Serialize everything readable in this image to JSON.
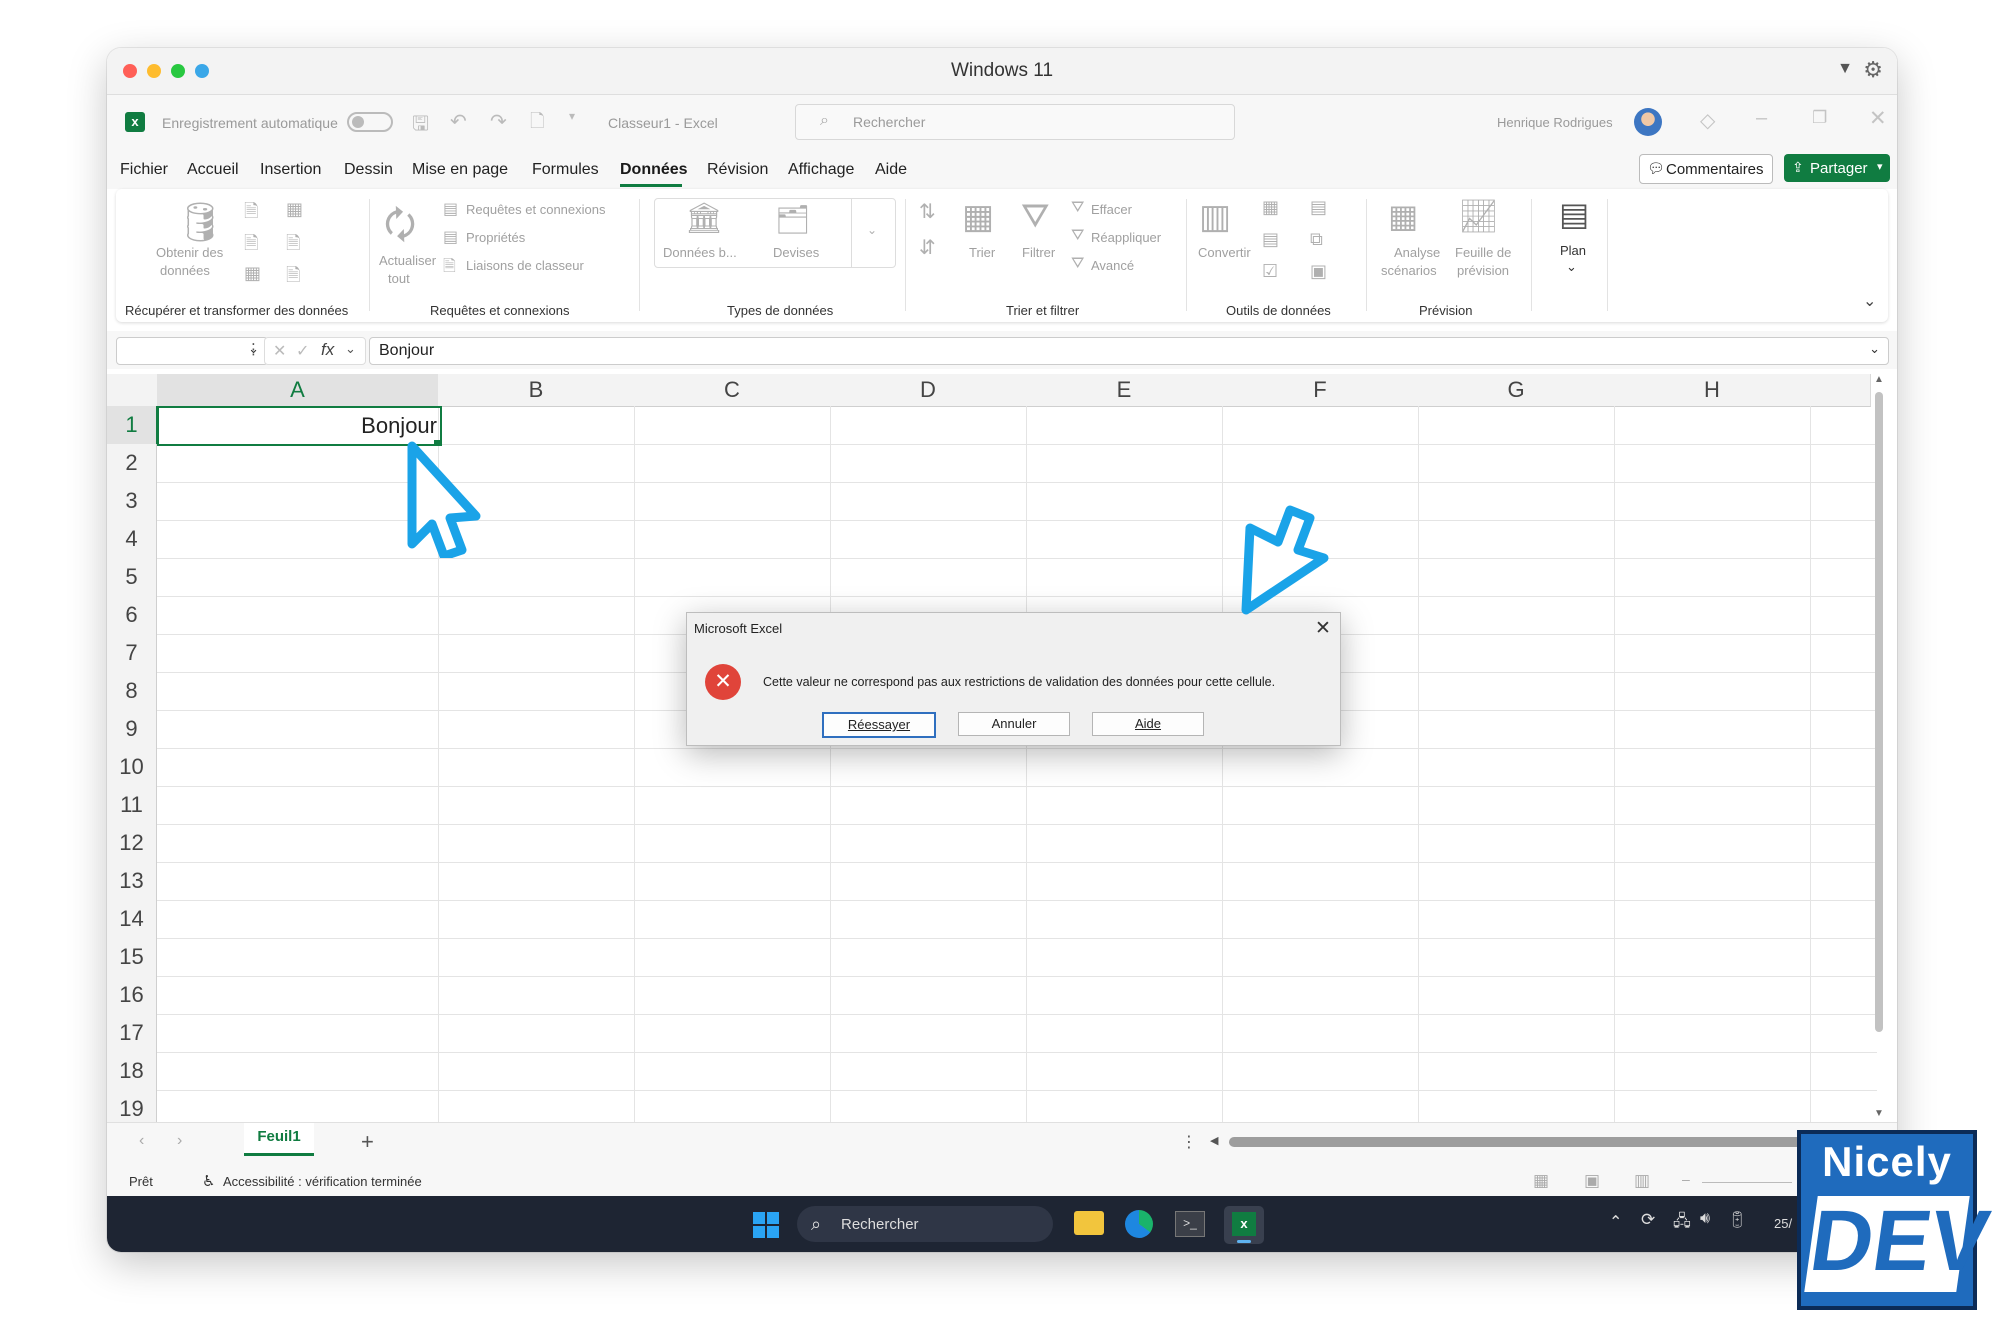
{
  "mac": {
    "title": "Windows 11"
  },
  "excel": {
    "autosave_label": "Enregistrement automatique",
    "doc_name": "Classeur1",
    "app_name": "Excel",
    "doc_sep": "-",
    "search_placeholder": "Rechercher",
    "user_name": "Henrique Rodrigues"
  },
  "menu": {
    "items": [
      "Fichier",
      "Accueil",
      "Insertion",
      "Dessin",
      "Mise en page",
      "Formules",
      "Données",
      "Révision",
      "Affichage",
      "Aide"
    ],
    "active": "Données",
    "comments": "Commentaires",
    "share": "Partager"
  },
  "ribbon": {
    "get_data": "Obtenir des",
    "get_data2": "données",
    "refresh": "Actualiser",
    "refresh2": "tout",
    "queries": "Requêtes et connexions",
    "properties": "Propriétés",
    "links": "Liaisons de classeur",
    "stock": "Données b...",
    "currencies": "Devises",
    "sort": "Trier",
    "filter": "Filtrer",
    "clear": "Effacer",
    "reapply": "Réappliquer",
    "advanced": "Avancé",
    "convert": "Convertir",
    "whatif": "Analyse",
    "whatif2": "scénarios",
    "forecast": "Feuille de",
    "forecast2": "prévision",
    "outline": "Plan",
    "groups": [
      "Récupérer et transformer des données",
      "Requêtes et connexions",
      "Types de données",
      "Trier et filtrer",
      "Outils de données",
      "Prévision"
    ]
  },
  "formula_bar": {
    "fx": "fx",
    "value": "Bonjour"
  },
  "grid": {
    "columns": [
      "A",
      "B",
      "C",
      "D",
      "E",
      "F",
      "G",
      "H"
    ],
    "rows": [
      "1",
      "2",
      "3",
      "4",
      "5",
      "6",
      "7",
      "8",
      "9",
      "10",
      "11",
      "12",
      "13",
      "14",
      "15",
      "16",
      "17",
      "18",
      "19"
    ],
    "a1": "Bonjour"
  },
  "sheets": {
    "tab": "Feuil1",
    "add": "+"
  },
  "status": {
    "ready": "Prêt",
    "accessibility": "Accessibilité : vérification terminée"
  },
  "taskbar": {
    "search": "Rechercher",
    "date": "25/"
  },
  "dialog": {
    "title": "Microsoft Excel",
    "message": "Cette valeur ne correspond pas aux restrictions de validation des données pour cette cellule.",
    "retry": "Réessayer",
    "cancel": "Annuler",
    "help": "Aide"
  },
  "logo": {
    "line1": "Nicely",
    "line2": "DEV"
  },
  "colors": {
    "excel_green": "#107c41",
    "cursor_blue": "#1aa3e8",
    "error_red": "#e0443a"
  }
}
